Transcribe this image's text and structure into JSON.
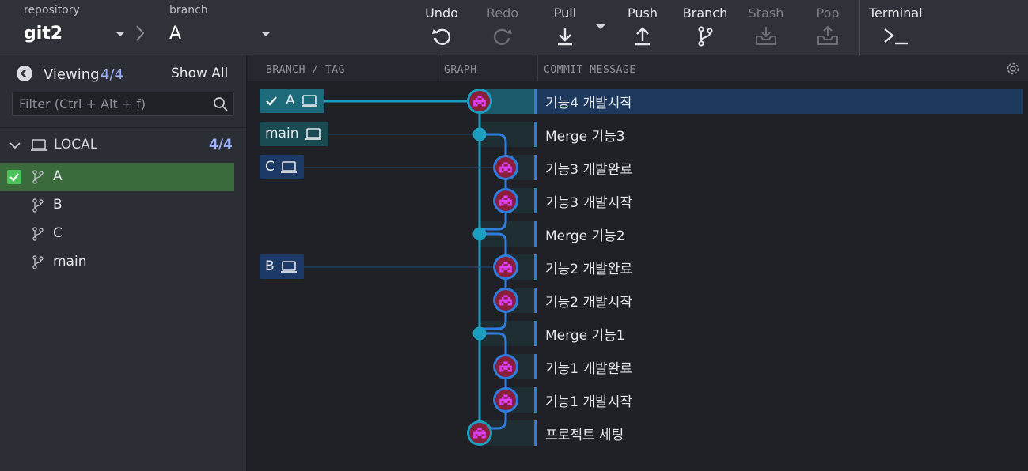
{
  "toolbar": {
    "repository_label": "repository",
    "repository_value": "git2",
    "branch_label": "branch",
    "branch_value": "A",
    "buttons": {
      "undo": "Undo",
      "redo": "Redo",
      "pull": "Pull",
      "push": "Push",
      "branch": "Branch",
      "stash": "Stash",
      "pop": "Pop",
      "terminal": "Terminal"
    }
  },
  "left_panel": {
    "viewing_label": "Viewing",
    "viewing_count": "4/4",
    "show_all": "Show All",
    "filter_placeholder": "Filter (Ctrl + Alt + f)",
    "local": {
      "label": "LOCAL",
      "count": "4/4",
      "branches": [
        {
          "name": "A",
          "checked_out": true
        },
        {
          "name": "B",
          "checked_out": false
        },
        {
          "name": "C",
          "checked_out": false
        },
        {
          "name": "main",
          "checked_out": false
        }
      ]
    }
  },
  "graph": {
    "columns": {
      "branch_tag": "BRANCH / TAG",
      "graph": "GRAPH",
      "commit_message": "COMMIT MESSAGE"
    },
    "tags": [
      {
        "name": "A",
        "row": 0,
        "checked_out": true
      },
      {
        "name": "main",
        "row": 1,
        "checked_out": false
      },
      {
        "name": "C",
        "row": 2,
        "checked_out": false
      },
      {
        "name": "B",
        "row": 5,
        "checked_out": false
      }
    ],
    "commits": [
      {
        "message": "기능4 개발시작",
        "lane": 0,
        "kind": "avatar",
        "selected": true
      },
      {
        "message": "Merge 기능3",
        "lane": 0,
        "kind": "merge"
      },
      {
        "message": "기능3 개발완료",
        "lane": 1,
        "kind": "avatar"
      },
      {
        "message": "기능3 개발시작",
        "lane": 1,
        "kind": "avatar"
      },
      {
        "message": "Merge 기능2",
        "lane": 0,
        "kind": "merge"
      },
      {
        "message": "기능2 개발완료",
        "lane": 1,
        "kind": "avatar"
      },
      {
        "message": "기능2 개발시작",
        "lane": 1,
        "kind": "avatar"
      },
      {
        "message": "Merge 기능1",
        "lane": 0,
        "kind": "merge"
      },
      {
        "message": "기능1 개발완료",
        "lane": 1,
        "kind": "avatar"
      },
      {
        "message": "기능1 개발시작",
        "lane": 1,
        "kind": "avatar"
      },
      {
        "message": "프로젝트 세팅",
        "lane": 0,
        "kind": "avatar"
      }
    ],
    "colors": {
      "lane_teal": "#1b9ec0",
      "lane_blue": "#2f7de0",
      "selected_row": "#1d3a5e",
      "tag_checked": "#1d6a7a",
      "tag_main": "#1a4b52",
      "tag_other": "#1d3a66",
      "avatar_bg": "#8a1f3a",
      "avatar_fg": "#e040ff"
    }
  }
}
